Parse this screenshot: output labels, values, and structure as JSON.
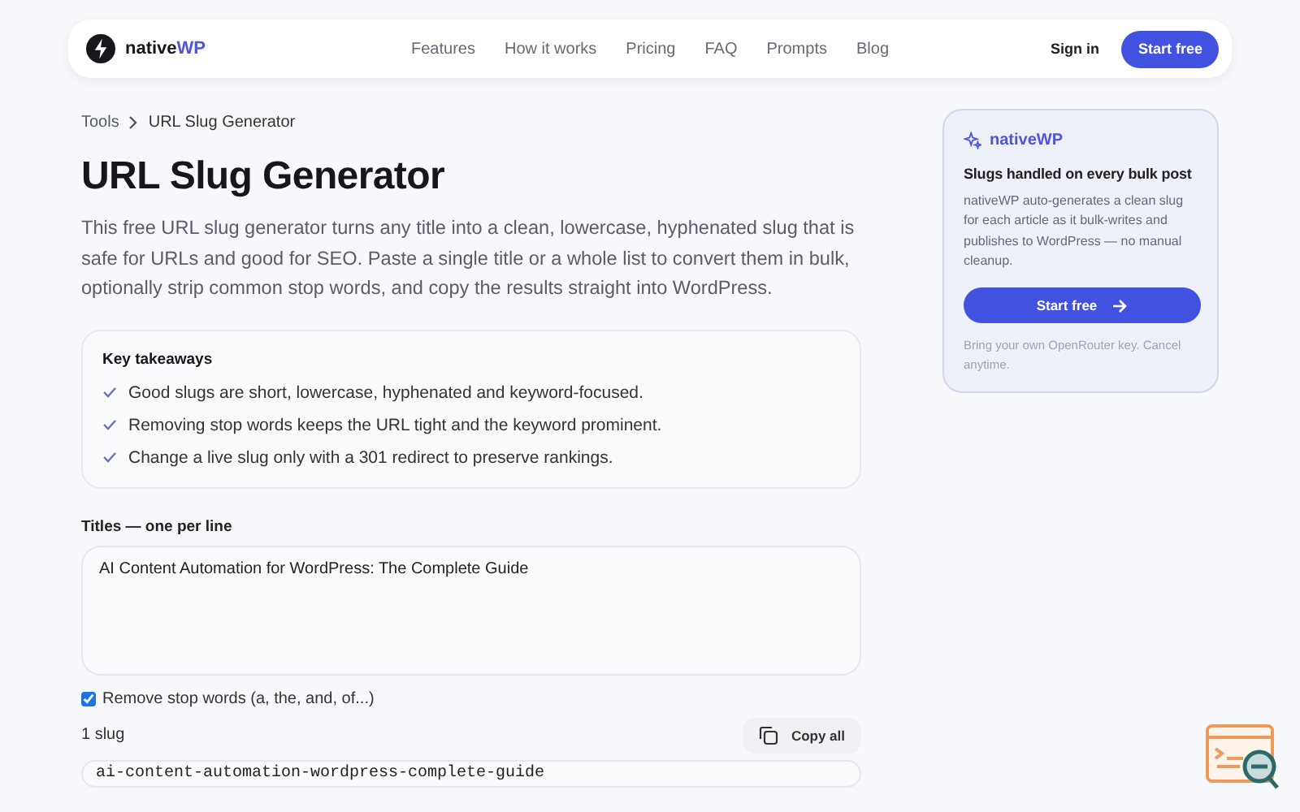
{
  "nav": {
    "brand": {
      "name": "native",
      "accent": "WP"
    },
    "links": [
      {
        "label": "Features"
      },
      {
        "label": "How it works"
      },
      {
        "label": "Pricing"
      },
      {
        "label": "FAQ"
      },
      {
        "label": "Prompts"
      },
      {
        "label": "Blog"
      }
    ],
    "sign_in": "Sign in",
    "cta": "Start free"
  },
  "breadcrumb": [
    "Tools",
    "URL Slug Generator"
  ],
  "title": "URL Slug Generator",
  "intro": "This free URL slug generator turns any title into a clean, lowercase, hyphenated slug that is safe for URLs and good for SEO. Paste a single title or a whole list to convert them in bulk, optionally strip common stop words, and copy the results straight into WordPress.",
  "takeaways": {
    "heading": "Key takeaways",
    "items": [
      "Good slugs are short, lowercase, hyphenated and keyword-focused.",
      "Removing stop words keeps the URL tight and the keyword prominent.",
      "Change a live slug only with a 301 redirect to preserve rankings."
    ]
  },
  "titles_field": {
    "label": "Titles — one per line",
    "value": "AI Content Automation for WordPress: The Complete Guide"
  },
  "stop_words": {
    "label": "Remove stop words (a, the, and, of...)",
    "checked": true
  },
  "results": {
    "count": "1 slug",
    "copy_button": "Copy all",
    "slugs": [
      "ai-content-automation-wordpress-complete-guide"
    ]
  },
  "promo": {
    "brand": "nativeWP",
    "heading": "Slugs handled on every bulk post",
    "body": "nativeWP auto-generates a clean slug for each article as it bulk-writes and publishes to WordPress — no manual cleanup.",
    "button": "Start free",
    "note": "Bring your own OpenRouter key. Cancel anytime."
  }
}
